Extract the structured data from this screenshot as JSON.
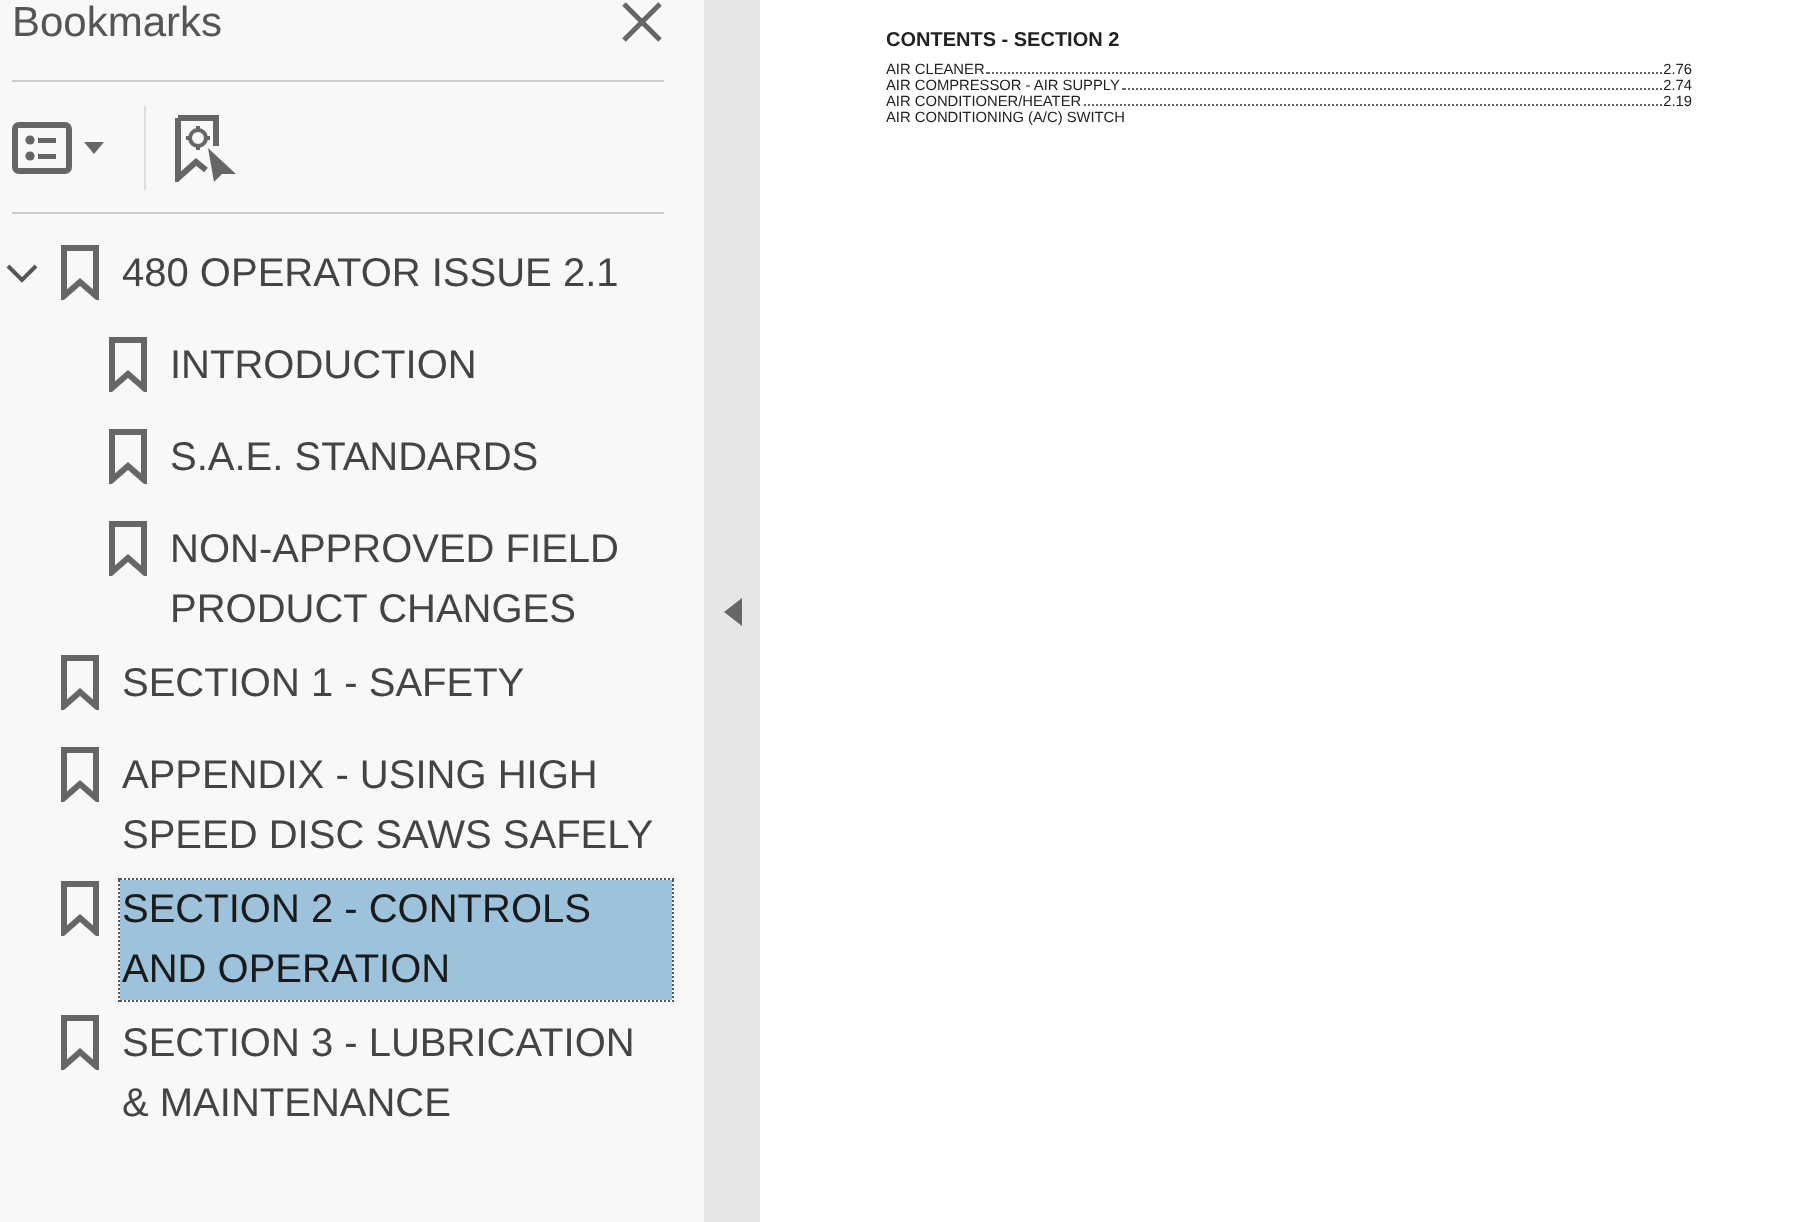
{
  "sidebar": {
    "title": "Bookmarks",
    "bookmarks": [
      {
        "label": "480 OPERATOR ISSUE 2.1",
        "expanded": true,
        "selected": false,
        "children": [
          {
            "label": "INTRODUCTION",
            "selected": false
          },
          {
            "label": "S.A.E. STANDARDS",
            "selected": false
          },
          {
            "label": "NON-APPROVED FIELD PRODUCT CHANGES",
            "selected": false
          }
        ]
      },
      {
        "label": "SECTION 1 - SAFETY",
        "selected": false
      },
      {
        "label": "APPENDIX - USING HIGH SPEED DISC SAWS SAFELY",
        "selected": false
      },
      {
        "label": "SECTION 2 - CONTROLS AND OPERATION",
        "selected": true
      },
      {
        "label": "SECTION 3 - LUBRICATION & MAINTENANCE",
        "selected": false
      }
    ]
  },
  "document": {
    "heading": "CONTENTS - SECTION 2",
    "entries": [
      {
        "title": "AIR CLEANER",
        "page": "2.76"
      },
      {
        "title": "AIR COMPRESSOR - AIR SUPPLY",
        "page": "2.74"
      },
      {
        "title": "AIR CONDITIONER/HEATER",
        "page": "2.19"
      },
      {
        "title": "AIR CONDITIONING (A/C) SWITCH"
      }
    ]
  }
}
